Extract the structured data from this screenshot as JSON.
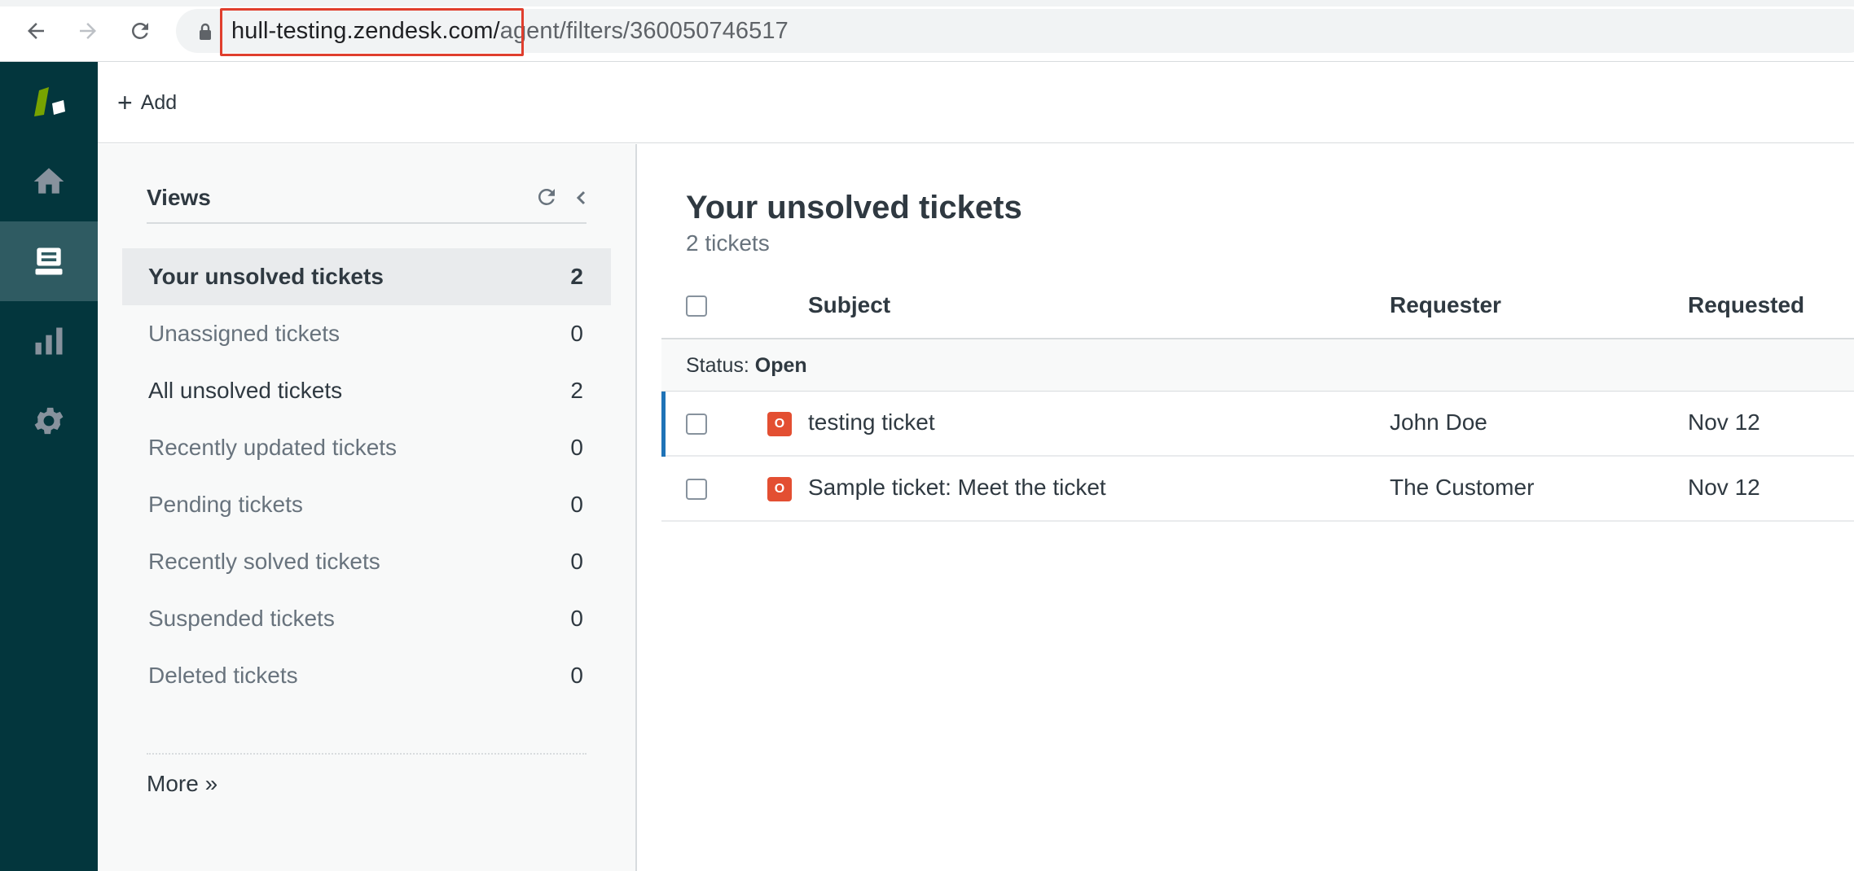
{
  "browser": {
    "url_host": "hull-testing.zendesk.com/",
    "url_path": "agent/filters/360050746517"
  },
  "header": {
    "add_label": "Add"
  },
  "views": {
    "title": "Views",
    "items": [
      {
        "label": "Your unsolved tickets",
        "count": "2"
      },
      {
        "label": "Unassigned tickets",
        "count": "0"
      },
      {
        "label": "All unsolved tickets",
        "count": "2"
      },
      {
        "label": "Recently updated tickets",
        "count": "0"
      },
      {
        "label": "Pending tickets",
        "count": "0"
      },
      {
        "label": "Recently solved tickets",
        "count": "0"
      },
      {
        "label": "Suspended tickets",
        "count": "0"
      },
      {
        "label": "Deleted tickets",
        "count": "0"
      }
    ],
    "more_label": "More »"
  },
  "main": {
    "title": "Your unsolved tickets",
    "subtitle": "2 tickets",
    "columns": {
      "subject": "Subject",
      "requester": "Requester",
      "requested": "Requested"
    },
    "group": {
      "prefix": "Status: ",
      "value": "Open"
    },
    "rows": [
      {
        "status": "O",
        "subject": "testing ticket",
        "requester": "John Doe",
        "requested": "Nov 12"
      },
      {
        "status": "O",
        "subject": "Sample ticket: Meet the ticket",
        "requester": "The Customer",
        "requested": "Nov 12"
      }
    ]
  },
  "colors": {
    "nav_bg": "#03363d",
    "open_status": "#e34f32",
    "highlight": "#e03e2d",
    "logo_green": "#78a300"
  }
}
